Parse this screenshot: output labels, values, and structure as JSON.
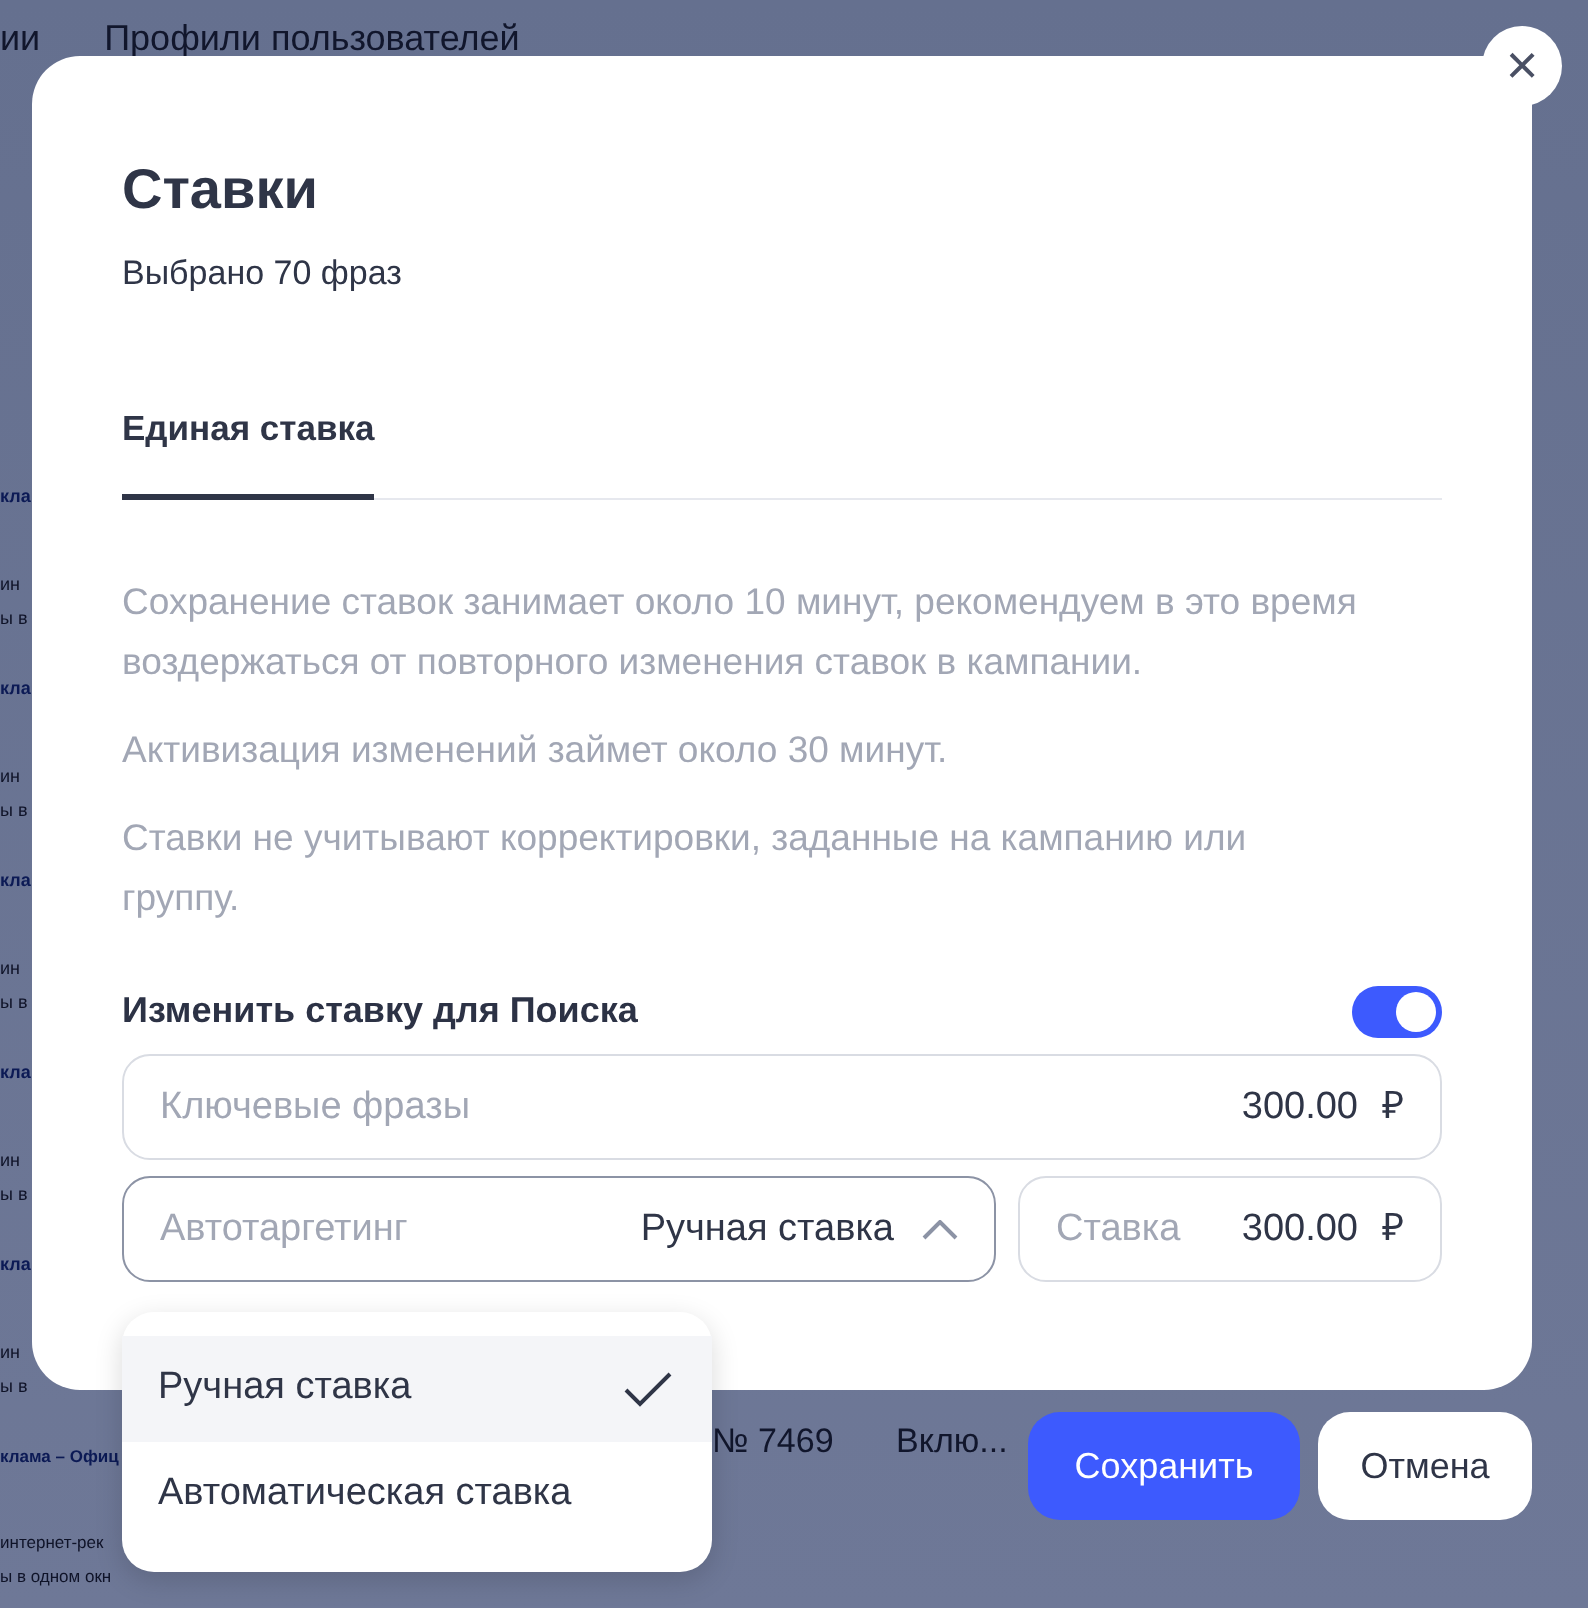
{
  "background": {
    "nav_tabs": [
      "ии",
      "Профили пользователей"
    ],
    "rows": [
      {
        "title": "кла",
        "line_1": "ин",
        "line_2": "ы в"
      },
      {
        "title": "кла",
        "line_1": "ин",
        "line_2": "ы в"
      },
      {
        "title": "кла",
        "line_1": "ин",
        "line_2": "ы в"
      },
      {
        "title": "кла",
        "line_1": "ин",
        "line_2": "ы в"
      },
      {
        "title": "кла",
        "line_1": "ин",
        "line_2": "ы в"
      },
      {
        "title": "клама – Офиц",
        "line_1": "интернет-рек",
        "line_2": "ы в одном окн",
        "number": "№ 7469",
        "status": "Вклю..."
      }
    ]
  },
  "dialog": {
    "title": "Ставки",
    "subtitle": "Выбрано 70 фраз",
    "close": "×",
    "tabs": [
      {
        "label": "Единая ставка",
        "selected": true
      }
    ],
    "notes": [
      "Сохранение ставок занимает около 10 минут, рекомендуем в это время воздержаться от повторного изменения ставок в кампании.",
      "Активизация изменений займет около 30 минут.",
      "Ставки не учитывают корректировки, заданные на кампанию или группу."
    ],
    "search_bid": {
      "label": "Изменить ставку для Поиска",
      "on": true
    },
    "keyphrases": {
      "label": "Ключевые фразы",
      "value": "300.00",
      "currency": "₽"
    },
    "autotargeting": {
      "label": "Автотаргетинг",
      "mode": "Ручная ставка",
      "expanded": true,
      "bid_label": "Ставка",
      "value": "300.00",
      "currency": "₽"
    }
  },
  "dropdown": [
    {
      "label": "Ручная ставка",
      "selected": true
    },
    {
      "label": "Автоматическая ставка",
      "selected": false
    }
  ],
  "buttons": {
    "save": "Сохранить",
    "cancel": "Отмена"
  }
}
